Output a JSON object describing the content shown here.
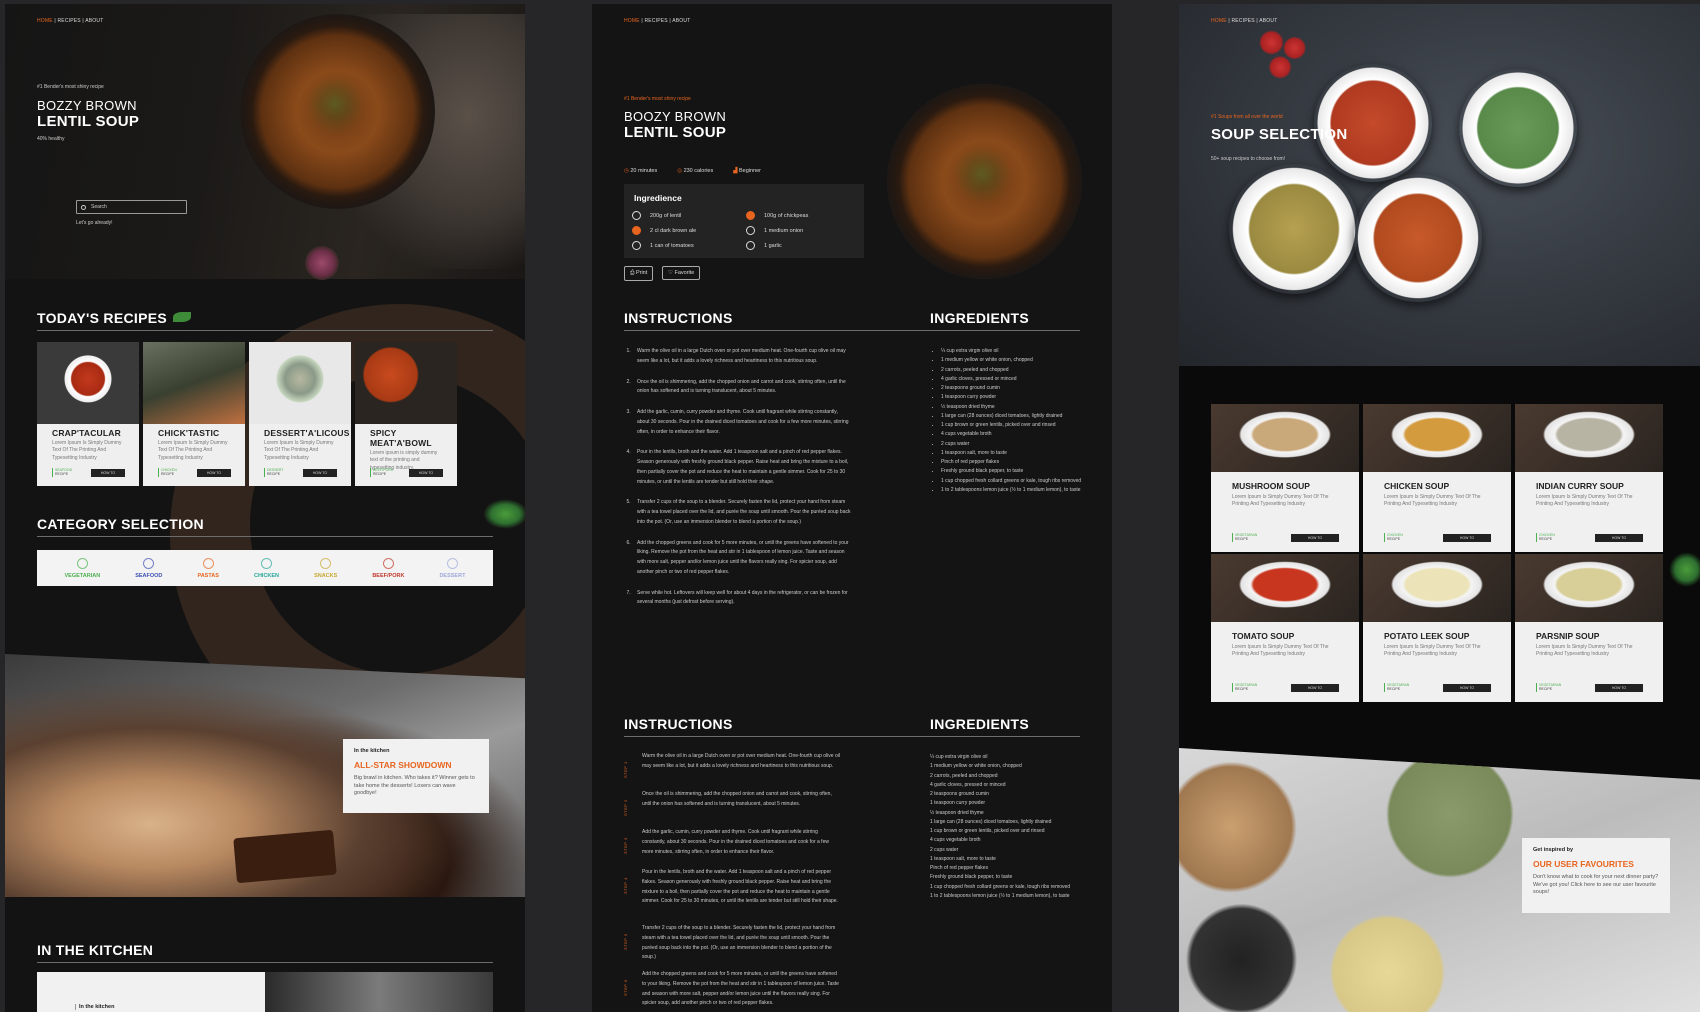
{
  "nav": {
    "home": "HOME",
    "rest": " | RECIPES | ABOUT"
  },
  "colors": {
    "accent": "#e8651f",
    "background": "#131313",
    "card": "#efefef"
  },
  "panel1": {
    "hero": {
      "tagline": "#1 Bender's most shiny recipe",
      "title_line1": "BOZZY BROWN",
      "title_line2": "LENTIL SOUP",
      "subtitle": "40% healthy",
      "search_placeholder": "Search",
      "search_hint": "Let's go already!"
    },
    "todays_recipes": {
      "heading": "TODAY'S RECIPES",
      "cards": [
        {
          "title": "CRAP'TACULAR",
          "desc": "Lorem Ipsum Is Simply Dummy Text Of The Printing And Typesetting Industry",
          "cat": "SEAFOOD",
          "type": "RECIPE",
          "button": "HOW TO",
          "icon": "seafood-dish-image"
        },
        {
          "title": "CHICK'TASTIC",
          "desc": "Lorem Ipsum Is Simply Dummy Text Of The Printing And Typesetting Industry",
          "cat": "CHICKEN",
          "type": "RECIPE",
          "button": "HOW TO",
          "icon": "chicken-dish-image"
        },
        {
          "title": "DESSERT'A'LICOUS",
          "desc": "Lorem Ipsum Is Simply Dummy Text Of The Printing And Typesetting Industry",
          "cat": "DESSERT",
          "type": "RECIPE",
          "button": "HOW TO",
          "icon": "dessert-dish-image"
        },
        {
          "title": "SPICY MEAT'A'BOWL",
          "desc": "Lorem ipsum is simply dummy text of the printing and typesetting industry.",
          "cat": "BEEF/PORK",
          "type": "RECIPE",
          "button": "HOW TO",
          "icon": "meat-dish-image"
        }
      ]
    },
    "category": {
      "heading": "CATEGORY SELECTION",
      "items": [
        {
          "label": "VEGETARIAN",
          "color": "#4caf50",
          "icon": "leaf-icon"
        },
        {
          "label": "SEAFOOD",
          "color": "#3f51b5",
          "icon": "fish-icon"
        },
        {
          "label": "PASTAS",
          "color": "#e8651f",
          "icon": "pasta-icon"
        },
        {
          "label": "CHICKEN",
          "color": "#26a69a",
          "icon": "chicken-icon"
        },
        {
          "label": "SNACKS",
          "color": "#c8a830",
          "icon": "snack-icon"
        },
        {
          "label": "BEEF/PORK",
          "color": "#c0392b",
          "icon": "steak-icon"
        },
        {
          "label": "DESSERT",
          "color": "#9fa8da",
          "icon": "cake-icon"
        }
      ]
    },
    "kitchen_feature": {
      "kicker": "In the kitchen",
      "title": "ALL-STAR SHOWDOWN",
      "text": "Big brawl in kitchen. Who takes it? Winner gets to take home the desserts! Losers can wave goodbye!"
    },
    "in_the_kitchen": {
      "heading": "IN THE KITCHEN",
      "kicker": "In the kitchen"
    }
  },
  "panel2": {
    "tagline": "#1 Bender's most shiny recipe",
    "title_line1": "BOOZY BROWN",
    "title_line2": "LENTIL SOUP",
    "meta": {
      "time": "20 minutes",
      "calories": "230 calories",
      "level": "Beginner"
    },
    "ingredience": {
      "heading": "Ingredience",
      "left": [
        {
          "text": "200g of lentil",
          "checked": false
        },
        {
          "text": "2 cl dark brown ale",
          "checked": true
        },
        {
          "text": "1 can of tomatoes",
          "checked": false
        }
      ],
      "right": [
        {
          "text": "100g of chickpeas",
          "checked": true
        },
        {
          "text": "1 medium onion",
          "checked": false
        },
        {
          "text": "1 garlic",
          "checked": false
        }
      ]
    },
    "buttons": {
      "print": "Print",
      "favorite": "Favorite"
    },
    "instructions_heading": "INSTRUCTIONS",
    "ingredients_heading": "INGREDIENTS",
    "steps": [
      "Warm the olive oil in a large Dutch oven or pot over medium heat. One-fourth cup olive oil may seem like a lot, but it adds a lovely richness and heartiness to this nutritious soup.",
      "Once the oil is shimmering, add the chopped onion and carrot and cook, stirring often, until the onion has softened and is turning translucent, about 5 minutes.",
      "Add the garlic, cumin, curry powder and thyme. Cook until fragrant while stirring constantly, about 30 seconds. Pour in the drained diced tomatoes and cook for a few more minutes, stirring often, in order to enhance their flavor.",
      "Pour in the lentils, broth and the water. Add 1 teaspoon salt and a pinch of red pepper flakes. Season generously with freshly ground black pepper. Raise heat and bring the mixture to a boil, then partially cover the pot and reduce the heat to maintain a gentle simmer. Cook for 25 to 30 minutes, or until the lentils are tender but still hold their shape.",
      "Transfer 2 cups of the soup to a blender. Securely fasten the lid, protect your hand from steam with a tea towel placed over the lid, and purée the soup until smooth. Pour the puréed soup back into the pot. (Or, use an immersion blender to blend a portion of the soup.)",
      "Add the chopped greens and cook for 5 more minutes, or until the greens have softened to your liking. Remove the pot from the heat and stir in 1 tablespoon of lemon juice. Taste and season with more salt, pepper and/or lemon juice until the flavors really sing. For spicier soup, add another pinch or two of red pepper flakes.",
      "Serve while hot. Leftovers will keep well for about 4 days in the refrigerator, or can be frozen for several months (just defrost before serving)."
    ],
    "ingredients": [
      "¼ cup extra virgin olive oil",
      "1 medium yellow or white onion, chopped",
      "2 carrots, peeled and chopped",
      "4 garlic cloves, pressed or minced",
      "2 teaspoons ground cumin",
      "1 teaspoon curry powder",
      "½ teaspoon dried thyme",
      "1 large can (28 ounces) diced tomatoes, lightly drained",
      "1 cup brown or green lentils, picked over and rinsed",
      "4 cups vegetable broth",
      "2 cups water",
      "1 teaspoon salt, more to taste",
      "Pinch of red pepper flakes",
      "Freshly ground black pepper, to taste",
      "1 cup chopped fresh collard greens or kale, tough ribs removed",
      "1 to 2 tablespoons lemon juice (½ to 1 medium lemon), to taste"
    ],
    "step_labels": [
      "STEP 1",
      "STEP 2",
      "STEP 3",
      "STEP 4",
      "STEP 5",
      "STEP 6"
    ]
  },
  "panel3": {
    "tagline": "#1 Soups from all over the world",
    "title": "SOUP SELECTION",
    "subtitle": "50+ soup recipes to choose from!",
    "cards": [
      {
        "title": "MUSHROOM SOUP",
        "desc": "Lorem Ipsum Is Simply Dummy Text Of The Printing And Typesetting Industry",
        "cat": "VEGETARIAN",
        "type": "RECIPE",
        "button": "HOW TO",
        "color": "#c9a87a"
      },
      {
        "title": "CHICKEN SOUP",
        "desc": "Lorem Ipsum Is Simply Dummy Text Of The Printing And Typesetting Industry",
        "cat": "CHICKEN",
        "type": "RECIPE",
        "button": "HOW TO",
        "color": "#d49a3e"
      },
      {
        "title": "INDIAN CURRY SOUP",
        "desc": "Lorem Ipsum Is Simply Dummy Text Of The Printing And Typesetting Industry",
        "cat": "CHICKEN",
        "type": "RECIPE",
        "button": "HOW TO",
        "color": "#b8b4a4"
      },
      {
        "title": "TOMATO SOUP",
        "desc": "Lorem Ipsum Is Simply Dummy Text Of The Printing And Typesetting Industry",
        "cat": "VEGETARIAN",
        "type": "RECIPE",
        "button": "HOW TO",
        "color": "#c8361f"
      },
      {
        "title": "POTATO LEEK SOUP",
        "desc": "Lorem Ipsum Is Simply Dummy Text Of The Printing And Typesetting Industry",
        "cat": "VEGETARIAN",
        "type": "RECIPE",
        "button": "HOW TO",
        "color": "#ece4b8"
      },
      {
        "title": "PARSNIP SOUP",
        "desc": "Lorem Ipsum Is Simply Dummy Text Of The Printing And Typesetting Industry",
        "cat": "VEGETARIAN",
        "type": "RECIPE",
        "button": "HOW TO",
        "color": "#d8ce98"
      }
    ],
    "favourites": {
      "kicker": "Get inspired by",
      "title": "OUR USER FAVOURITES",
      "text": "Don't know what to cook for your next dinner party? We've got you! Click here to see our user favourite soups!"
    }
  }
}
